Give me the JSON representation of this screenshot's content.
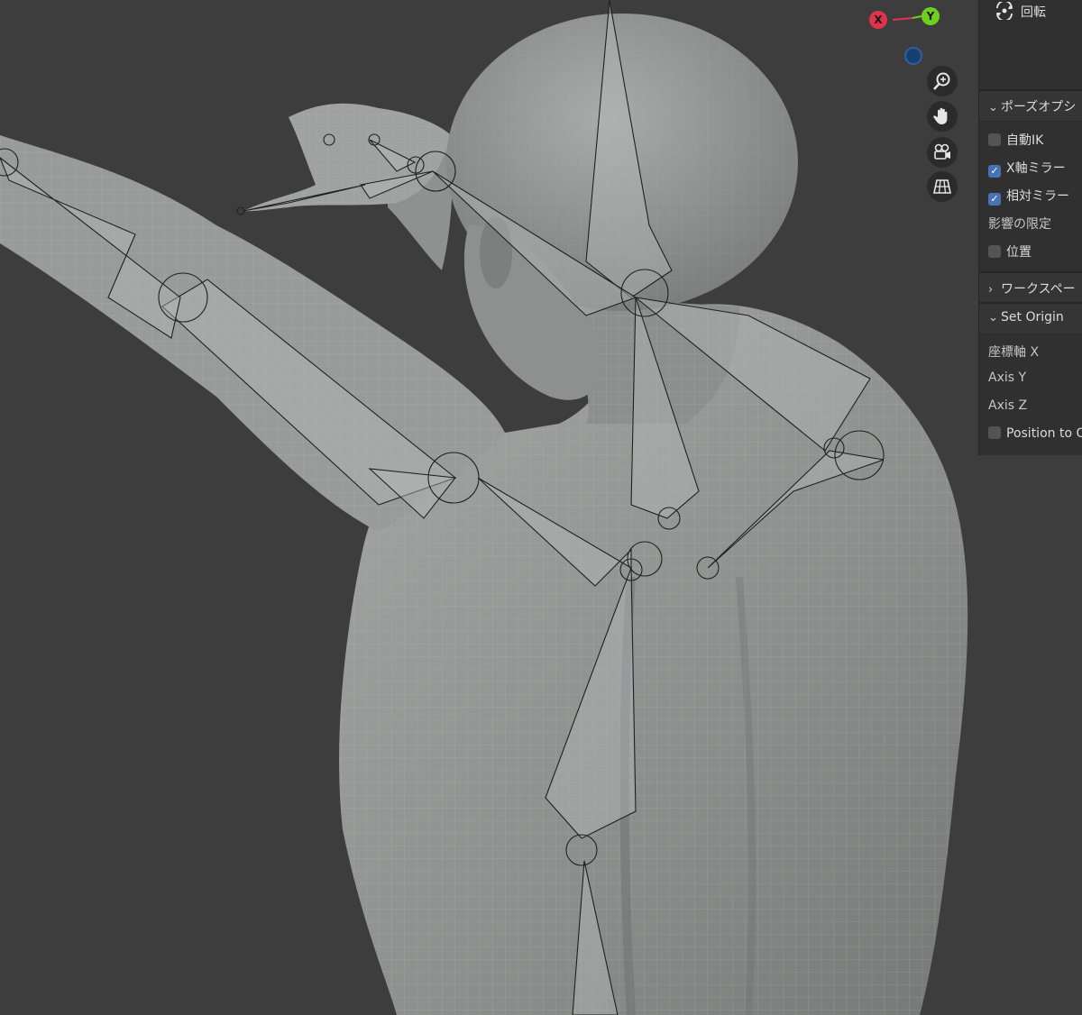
{
  "gizmo": {
    "x_label": "X",
    "y_label": "Y"
  },
  "nav_buttons": {
    "zoom": "zoom-icon",
    "pan": "hand-icon",
    "camera": "camera-icon",
    "ortho": "grid-icon"
  },
  "panel": {
    "rotate_label": "回転",
    "pose_options": {
      "header": "ポーズオプシ",
      "auto_ik": {
        "label": "自動IK",
        "checked": false
      },
      "x_mirror": {
        "label": "X軸ミラー",
        "checked": true
      },
      "relative_mirror": {
        "label": "相対ミラー",
        "checked": true
      },
      "affect_only": "影響の限定",
      "location": {
        "label": "位置",
        "checked": false
      }
    },
    "workspace": {
      "header": "ワークスペー"
    },
    "set_origin": {
      "header": "Set Origin",
      "axis_x": "座標軸 X",
      "axis_y": "Axis Y",
      "axis_z": "Axis Z",
      "position_to": {
        "label": "Position to O",
        "checked": false
      }
    }
  },
  "colors": {
    "background": "#3d3d3d",
    "mesh": "#9ea09f",
    "panel": "#303030",
    "checkbox_on": "#4772b3",
    "axis_x": "#e0334d",
    "axis_y": "#6fcf20",
    "axis_z": "#17406f"
  }
}
